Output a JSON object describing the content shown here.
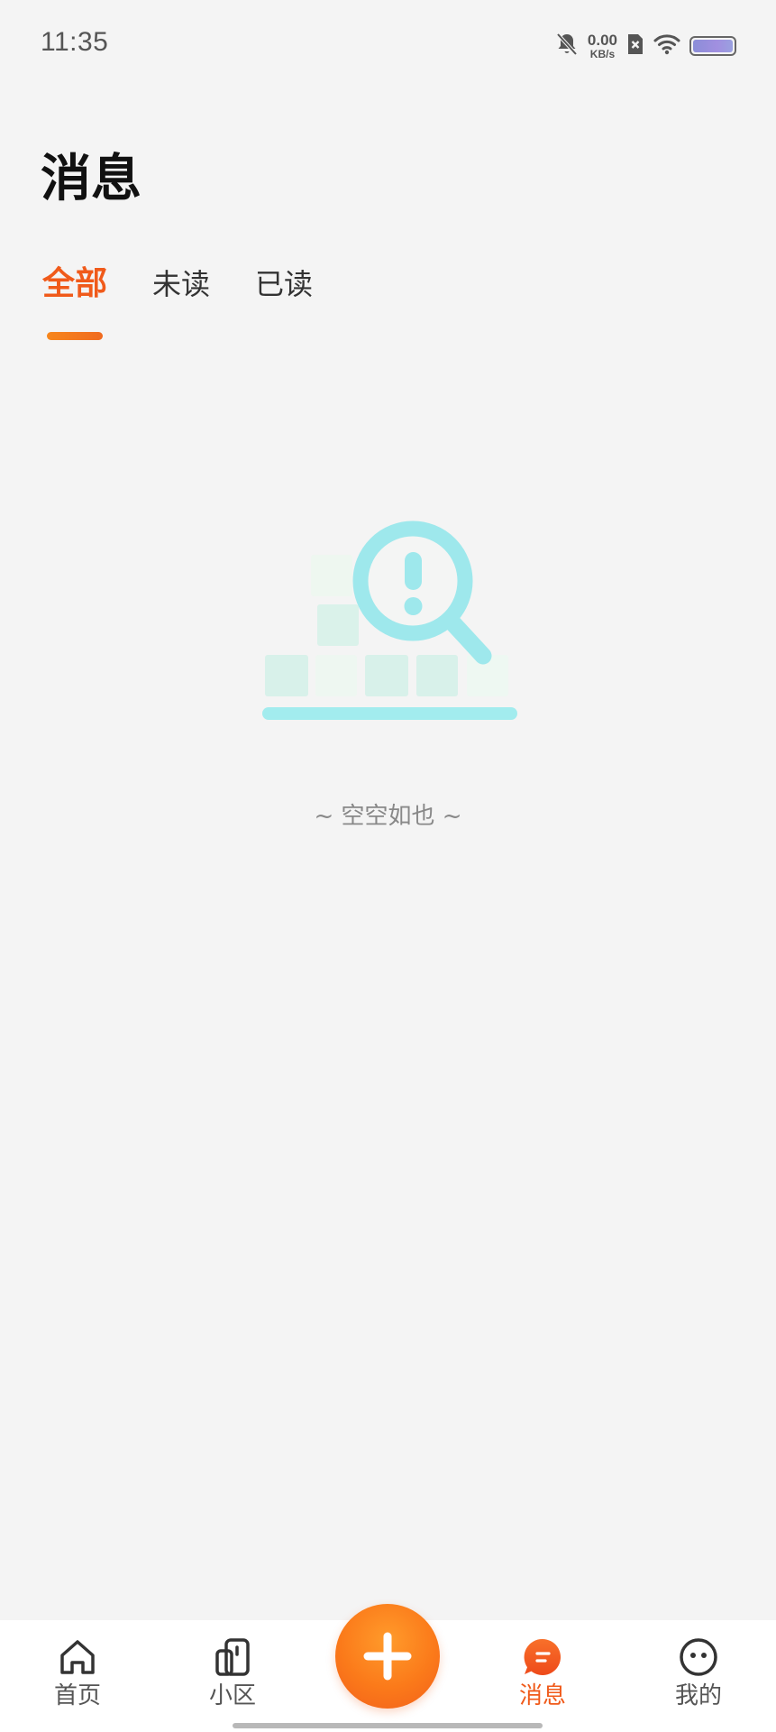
{
  "status_bar": {
    "time": "11:35",
    "net_speed_value": "0.00",
    "net_speed_unit": "KB/s",
    "icons": [
      "bell-off-icon",
      "no-sim-icon",
      "wifi-icon",
      "battery-icon"
    ]
  },
  "header": {
    "title": "消息"
  },
  "tabs": [
    {
      "label": "全部",
      "active": true
    },
    {
      "label": "未读",
      "active": false
    },
    {
      "label": "已读",
      "active": false
    }
  ],
  "empty_state": {
    "icon": "empty-search-illustration",
    "text": "~ 空空如也 ~"
  },
  "bottom_nav": {
    "items": [
      {
        "label": "首页",
        "icon": "home-icon",
        "active": false
      },
      {
        "label": "小区",
        "icon": "community-icon",
        "active": false
      },
      {
        "label": "消息",
        "icon": "message-icon",
        "active": true
      },
      {
        "label": "我的",
        "icon": "profile-icon",
        "active": false
      }
    ],
    "center_button_icon": "plus-icon"
  },
  "colors": {
    "accent": "#f05a1a",
    "fab_orange": "#fb7a1a",
    "background": "#f4f4f4",
    "illustration_cyan": "#9ee8ec"
  }
}
